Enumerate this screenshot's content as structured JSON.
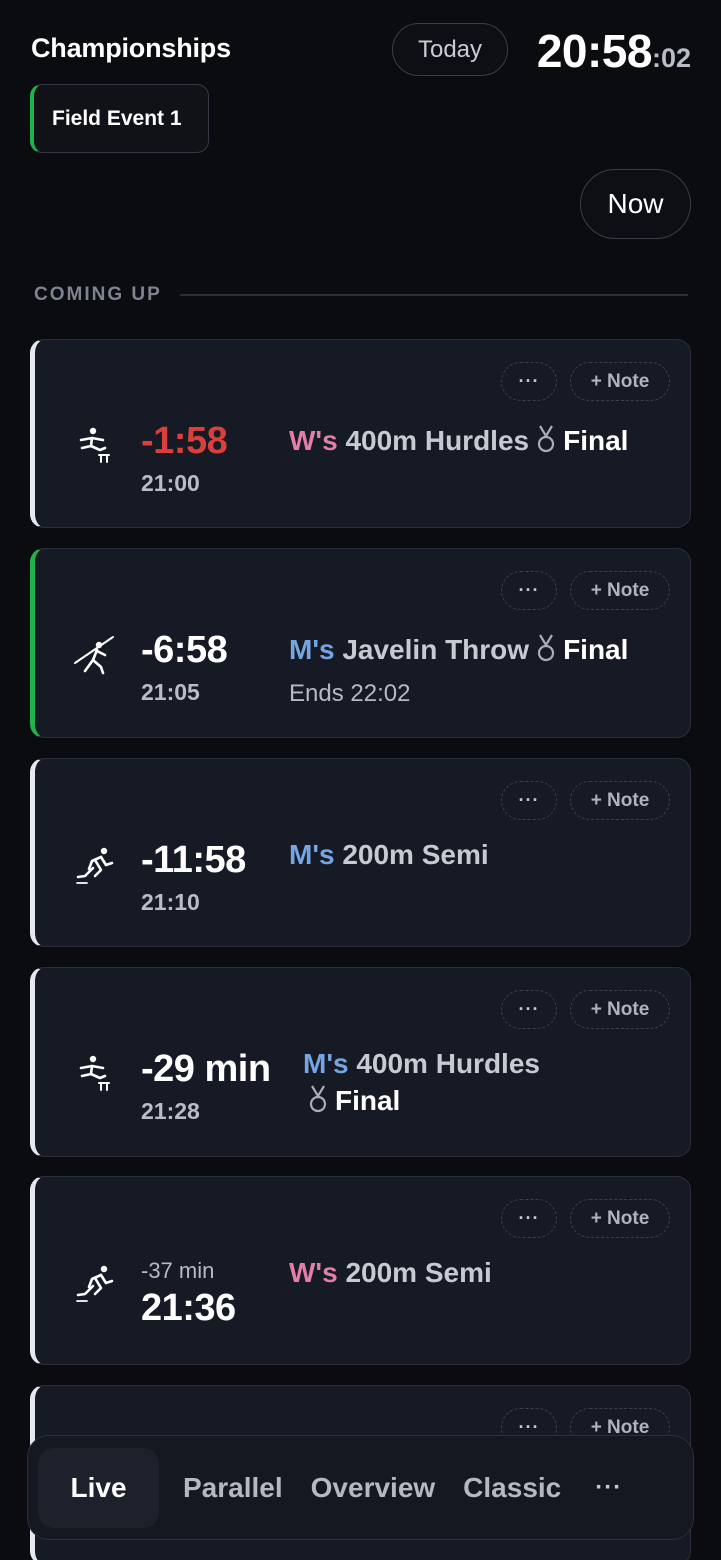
{
  "header": {
    "title": "Championships",
    "today_label": "Today",
    "clock_hm": "20:58",
    "clock_sec": ":02"
  },
  "filter_chip": {
    "label": "Field Event 1",
    "accent": "#22b14c"
  },
  "now_label": "Now",
  "section_label": "COMING UP",
  "card_actions": {
    "more_label": "···",
    "note_label": "+ Note"
  },
  "events": [
    {
      "icon": "hurdles-icon",
      "countdown": "-1:58",
      "time": "21:00",
      "gender": "W's",
      "name": "400m Hurdles",
      "round": "Final",
      "sub": ""
    },
    {
      "icon": "javelin-icon",
      "countdown": "-6:58",
      "time": "21:05",
      "gender": "M's",
      "name": "Javelin Throw",
      "round": "Final",
      "sub": "Ends 22:02"
    },
    {
      "icon": "sprint-icon",
      "countdown": "-11:58",
      "time": "21:10",
      "gender": "M's",
      "name": "200m Semi",
      "round": "",
      "sub": ""
    },
    {
      "icon": "hurdles-icon",
      "countdown": "-29 min",
      "time": "21:28",
      "gender": "M's",
      "name": "400m Hurdles",
      "round": "Final",
      "sub": ""
    },
    {
      "icon": "sprint-icon",
      "countdown": "-37 min",
      "time": "21:36",
      "gender": "W's",
      "name": "200m Semi",
      "round": "",
      "sub": ""
    }
  ],
  "colors": {
    "women": "#e27ea7",
    "men": "#75a6e3",
    "overdue": "#d9403b",
    "field_accent": "#22b14c"
  },
  "tabs": {
    "live": "Live",
    "parallel": "Parallel",
    "overview": "Overview",
    "classic": "Classic",
    "more": "···"
  }
}
